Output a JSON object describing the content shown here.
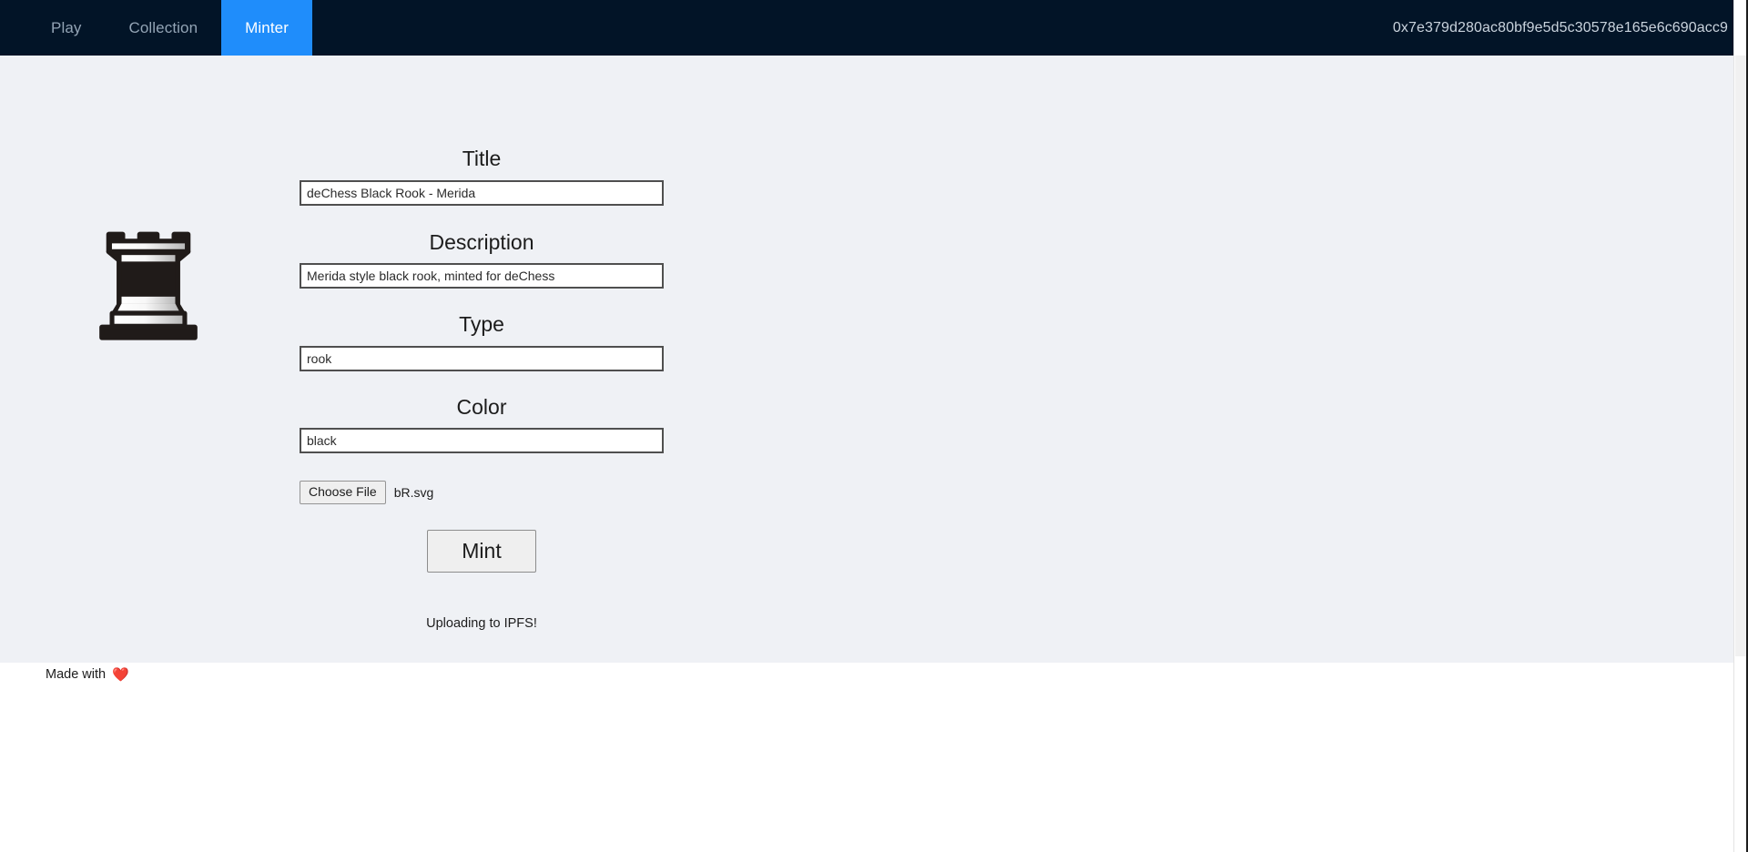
{
  "navbar": {
    "items": [
      {
        "label": "Play",
        "active": false
      },
      {
        "label": "Collection",
        "active": false
      },
      {
        "label": "Minter",
        "active": true
      }
    ],
    "wallet_address": "0x7e379d280ac80bf9e5d5c30578e165e6c690acc9",
    "background_color": "#021427",
    "active_color": "#1f8dfb"
  },
  "artwork": {
    "alt": "black-rook-chess-piece",
    "piece_type": "rook",
    "piece_color": "black",
    "style": "Merida"
  },
  "form": {
    "fields": [
      {
        "label": "Title",
        "value": "deChess Black Rook - Merida",
        "placeholder": "Title"
      },
      {
        "label": "Description",
        "value": "Merida style black rook, minted for deChess",
        "placeholder": "Description"
      },
      {
        "label": "Type",
        "value": "rook",
        "placeholder": "Type"
      },
      {
        "label": "Color",
        "value": "black",
        "placeholder": "Color"
      }
    ],
    "file_input": {
      "button_label": "Choose File",
      "file_name": "bR.svg"
    },
    "mint_button_label": "Mint",
    "status_message": "Uploading to IPFS!"
  },
  "footer": {
    "text": "Made with",
    "heart": "❤️"
  },
  "page": {
    "background_color": "#eff1f5"
  }
}
